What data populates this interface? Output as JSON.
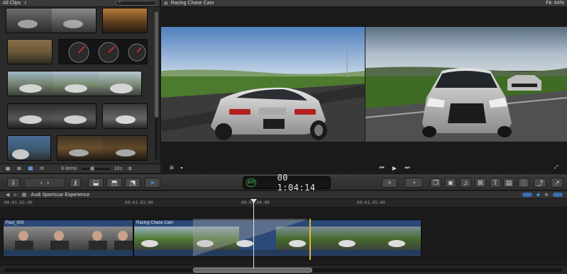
{
  "browser": {
    "library_label": "All Clips",
    "search_placeholder": "",
    "footer": {
      "items_count": "9 items",
      "duration_label": "10s"
    }
  },
  "viewer": {
    "title": "Racing Chase Cam",
    "zoom_label": "Fit:",
    "zoom_value": "64%"
  },
  "toolbar": {
    "timecode": "00 1:04:14",
    "timecode_badge": "100"
  },
  "timeline": {
    "project_title": "Audi Sportscar Experience",
    "ruler_labels": [
      "00:01:02:00",
      "00:01:03:00",
      "00:01:04:00",
      "00:01:05:00"
    ],
    "clips": [
      {
        "name": "Paul_003"
      },
      {
        "name": "Racing Chase Cam"
      }
    ]
  },
  "icons": {
    "browser_search": "search-icon",
    "viewer_play": "play-icon",
    "viewer_prev": "previous-icon",
    "viewer_next": "next-icon",
    "toolbar_tools": [
      "import-icon",
      "key-icon",
      "append-icon",
      "insert-icon",
      "overwrite-icon",
      "select-tool-icon",
      "magic-wand-icon",
      "retime-icon",
      "media-browser-icon",
      "photo-icon",
      "music-icon",
      "titles-icon",
      "generators-icon",
      "themes-icon",
      "inspector-icon",
      "share-icon"
    ]
  },
  "colors": {
    "accent_blue": "#3b6db3",
    "clip_blue": "#243b5c",
    "skimmer_yellow": "#e8b326",
    "timecode_green": "#5bd36a"
  }
}
